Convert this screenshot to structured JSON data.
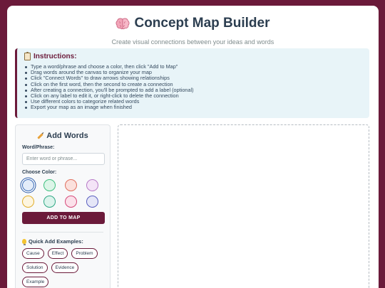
{
  "header": {
    "title": "Concept Map Builder",
    "subtitle": "Create visual connections between your ideas and words",
    "icon": "brain-icon"
  },
  "instructions": {
    "title": "Instructions:",
    "icon": "clipboard-icon",
    "items": [
      "Type a word/phrase and choose a color, then click \"Add to Map\"",
      "Drag words around the canvas to organize your map",
      "Click \"Connect Words\" to draw arrows showing relationships",
      "Click on the first word, then the second to create a connection",
      "After creating a connection, you'll be prompted to add a label (optional)",
      "Click on any label to edit it, or right-click to delete the connection",
      "Use different colors to categorize related words",
      "Export your map as an image when finished"
    ]
  },
  "sidebar": {
    "title": "Add Words",
    "icon": "pencil-icon",
    "word_label": "Word/Phrase:",
    "word_placeholder": "Enter word or phrase...",
    "word_value": "",
    "color_label": "Choose Color:",
    "colors": [
      {
        "bg": "#e3ecf9",
        "border": "#3b6cb7",
        "selected": true
      },
      {
        "bg": "#dcf5e8",
        "border": "#3fbf7f",
        "selected": false
      },
      {
        "bg": "#fbe0dc",
        "border": "#e0705f",
        "selected": false
      },
      {
        "bg": "#f4e4f7",
        "border": "#b77ac7",
        "selected": false
      },
      {
        "bg": "#fdf5df",
        "border": "#e0ad2b",
        "selected": false
      },
      {
        "bg": "#dcf3ec",
        "border": "#2fa884",
        "selected": false
      },
      {
        "bg": "#fbe1ea",
        "border": "#d64a7a",
        "selected": false
      },
      {
        "bg": "#e5e6f7",
        "border": "#5a5fbf",
        "selected": false
      }
    ],
    "add_button": "ADD TO MAP",
    "quick_title": "Quick Add Examples:",
    "quick_icon": "bulb-icon",
    "examples": [
      "Cause",
      "Effect",
      "Problem",
      "Solution",
      "Evidence",
      "Example"
    ]
  }
}
